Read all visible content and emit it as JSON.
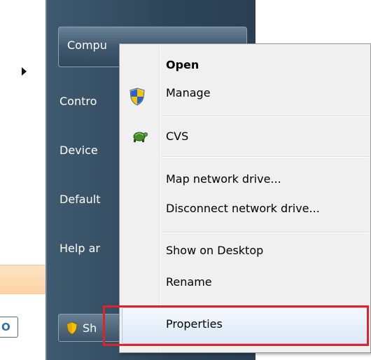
{
  "start_menu": {
    "right_pane": {
      "computer_label": "Compu",
      "items": [
        {
          "label": "Contro"
        },
        {
          "label": "Device"
        },
        {
          "label": "Default"
        },
        {
          "label": "Help ar"
        }
      ],
      "shutdown_label": "Sh"
    },
    "search_fragment": "O"
  },
  "context_menu": {
    "items": [
      {
        "label": "Open",
        "bold": true
      },
      {
        "label": "Manage",
        "icon": "uac-shield-icon"
      },
      {
        "label": "CVS",
        "icon": "tortoise-icon"
      },
      {
        "label": "Map network drive..."
      },
      {
        "label": "Disconnect network drive..."
      },
      {
        "label": "Show on Desktop"
      },
      {
        "label": "Rename"
      },
      {
        "label": "Properties",
        "highlighted": true
      }
    ]
  },
  "colors": {
    "highlight_box": "#e0222b",
    "pane_dark": "#2e4558",
    "menu_bg": "#f0f0f0"
  }
}
